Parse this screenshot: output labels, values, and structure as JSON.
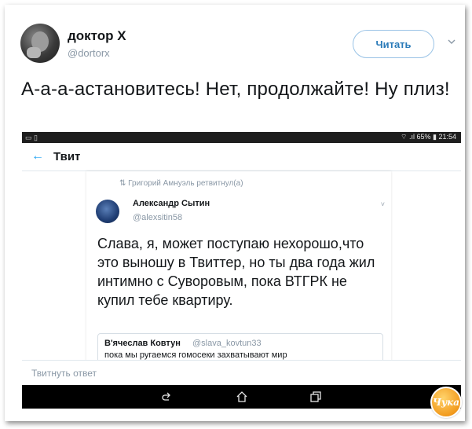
{
  "author": {
    "name": "доктор Х",
    "handle": "@dortorx"
  },
  "follow_button_label": "Читать",
  "tweet_text": "А-а-а-астановитесь! Нет, продолжайте! Ну плиз!",
  "screenshot": {
    "statusbar": {
      "left_icons": "▭ ▯",
      "right_text": "⌔ .ıl 65% ▮ 21:54"
    },
    "appbar": {
      "back_icon": "←",
      "title": "Твит"
    },
    "embedded_tweet": {
      "retweet_line": "⇅ Григорий Амнуэль ретвитнул(а)",
      "author_name": "Александр Сытин",
      "author_handle": "@alexsitin58",
      "chevron": "˅",
      "text": "Слава, я, может  поступаю нехорошо,что это выношу в Твиттер, но ты два года жил интимно с Суворовым, пока ВТГРК не купил тебе квартиру.",
      "quote": {
        "name": "В'ячеслав Ковтун",
        "handle": "@slava_kovtun33",
        "text": "пока мы ругаемся гомосеки захватывают мир"
      }
    },
    "reply_placeholder": "Твитнуть ответ",
    "nav_icons": [
      "back-nav-icon",
      "home-nav-icon",
      "recent-apps-icon"
    ]
  },
  "badge_text": "Чука",
  "colors": {
    "accent": "#2b7bb9",
    "follow_border": "#9ac3e6",
    "muted": "#8a98a6",
    "statusbar_bg": "#1e1e1e",
    "navbar_bg": "#000000",
    "badge": "#f29b1e"
  }
}
